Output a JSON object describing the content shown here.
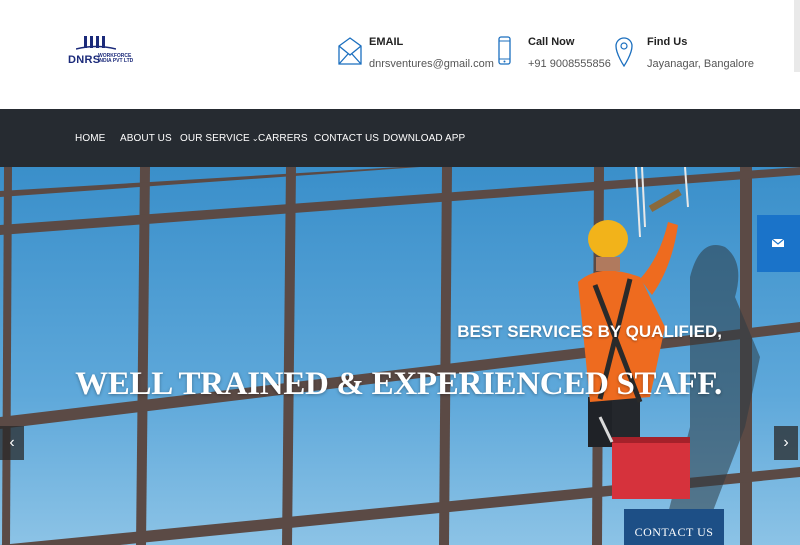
{
  "header": {
    "logo": {
      "brand": "DNRS",
      "sub_line1": "WORKFORCE",
      "sub_line2": "INDIA PVT LTD"
    },
    "contacts": [
      {
        "icon": "envelope-icon",
        "title": "EMAIL",
        "value": "dnrsventures@gmail.com"
      },
      {
        "icon": "phone-icon",
        "title": "Call Now",
        "value": "+91 9008555856"
      },
      {
        "icon": "map-pin-icon",
        "title": "Find Us",
        "value": "Jayanagar, Bangalore"
      }
    ]
  },
  "nav": {
    "items": [
      {
        "label": "HOME"
      },
      {
        "label": "ABOUT US"
      },
      {
        "label": "OUR SERVICE",
        "has_dropdown": true
      },
      {
        "label": "CARRERS"
      },
      {
        "label": "CONTACT US"
      },
      {
        "label": "DOWNLOAD APP"
      }
    ],
    "background": "#262b31"
  },
  "hero": {
    "line1": "BEST SERVICES BY QUALIFIED,",
    "line2": "WELL TRAINED & EXPERIENCED STAFF.",
    "cta_label": "CONTACT US",
    "prev_arrow": "‹",
    "next_arrow": "›"
  },
  "colors": {
    "accent": "#1d4f86",
    "side_button": "#1a73c9",
    "logo_blue": "#1b2a7a"
  }
}
